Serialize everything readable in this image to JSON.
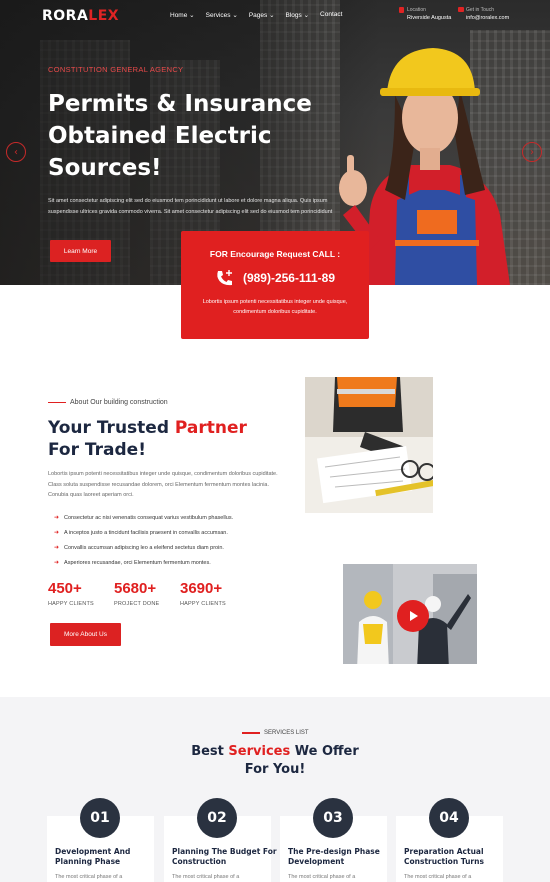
{
  "header": {
    "logo": {
      "main": "RORA",
      "accent": "LEX"
    },
    "nav": [
      {
        "label": "Home",
        "caret": true
      },
      {
        "label": "Services",
        "caret": true
      },
      {
        "label": "Pages",
        "caret": true
      },
      {
        "label": "Blogs",
        "caret": true
      },
      {
        "label": "Contact",
        "caret": false
      }
    ],
    "location": {
      "title": "Location",
      "value": "Riverside Augusta"
    },
    "mail": {
      "title": "Get in Touch",
      "value": "info@roralex.com"
    }
  },
  "hero": {
    "subtitle": "CONSTITUTION GENERAL AGENCY",
    "title": "Permits & Insurance Obtained Electric Sources!",
    "text": "Sit amet consectetur adipiscing elit sed do eiusmod tem porincididunt ut labore et dolore magna aliqua. Quis ipsum suspendisse ultrices gravida commodo viverra. Sit amet consectetur adipiscing elit sed do eiusmod tem porincididunt",
    "button": "Learn More",
    "prev": "‹",
    "next": "›"
  },
  "callbox": {
    "heading": "FOR Encourage Request CALL :",
    "phone": "(989)-256-111-89",
    "text": "Lobortis ipsum potenti necessitatibus integer unde quisque, condimentum doloribus cupiditate."
  },
  "about": {
    "kicker": "About Our building construction",
    "title_pre": "Your Trusted ",
    "title_accent": "Partner",
    "title_line2": "For Trade!",
    "text": "Lobortis ipsum potenti necessitatibus integer unde quisque, condimentum doloribus cupiditate. Class soluta suspendisse recusandae dolorem, orci Elementum fermentum montes lacinia. Conubia quas laoreet aperiam orci.",
    "checks": [
      "Consectetur ac nisi venenatis consequat varius vestibulum phasellus.",
      "A inceptos justo a tincidunt facilisis praesent in convallis accumsan.",
      "Convallis accumsan adipiscing leo a eleifend sectetus diam proin.",
      "Asperiores recusandae, orci Elementum fermentum montes."
    ],
    "stats": [
      {
        "value": "450+",
        "label": "HAPPY CLIENTS"
      },
      {
        "value": "5680+",
        "label": "PROJECT DONE"
      },
      {
        "value": "3690+",
        "label": "HAPPY CLIENTS"
      }
    ],
    "button": "More About Us"
  },
  "services": {
    "kicker": "SERVICES LIST",
    "title_pre": "Best ",
    "title_accent": "Services",
    "title_post": " We Offer",
    "title_line2": "For You!",
    "cards": [
      {
        "num": "01",
        "title": "Development And Planning Phase",
        "text": "The most critical phase of a"
      },
      {
        "num": "02",
        "title": "Planning The Budget For Construction",
        "text": "The most critical phase of a"
      },
      {
        "num": "03",
        "title": "The Pre-design Phase Development",
        "text": "The most critical phase of a"
      },
      {
        "num": "04",
        "title": "Preparation Actual Construction Turns",
        "text": "The most critical phase of a"
      }
    ]
  },
  "colors": {
    "accent": "#e02020",
    "dark": "#1c2740",
    "circle": "#2a3240"
  }
}
